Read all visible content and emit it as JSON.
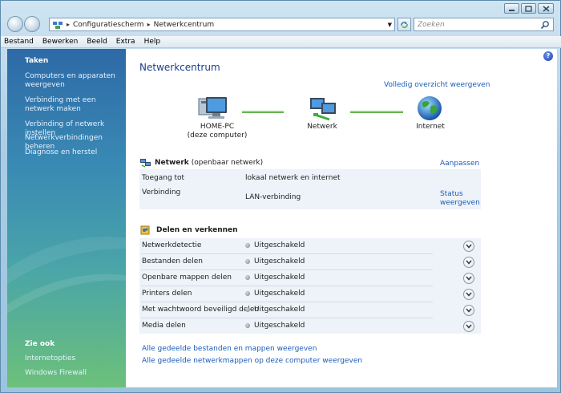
{
  "window": {
    "minimize": "",
    "maximize": "",
    "close": ""
  },
  "address": {
    "crumbs": [
      "Configuratiescherm",
      "Netwerkcentrum"
    ],
    "search_placeholder": "Zoeken"
  },
  "menu": [
    "Bestand",
    "Bewerken",
    "Beeld",
    "Extra",
    "Help"
  ],
  "left_pane": {
    "tasks_heading": "Taken",
    "tasks": [
      "Computers en apparaten weergeven",
      "Verbinding met een netwerk maken",
      "Verbinding of netwerk instellen",
      "Netwerkverbindingen beheren",
      "Diagnose en herstel"
    ],
    "see_also_heading": "Zie ook",
    "see_also": [
      "Internetopties",
      "Windows Firewall"
    ]
  },
  "main": {
    "help": "?",
    "title": "Netwerkcentrum",
    "overview_link": "Volledig overzicht weergeven",
    "map": {
      "pc_name": "HOME-PC",
      "pc_sub": "(deze computer)",
      "network": "Netwerk",
      "internet": "Internet"
    },
    "network": {
      "name": "Netwerk",
      "type": "(openbaar netwerk)",
      "customize": "Aanpassen",
      "access_label": "Toegang tot",
      "access_value": "lokaal netwerk en internet",
      "connection_label": "Verbinding",
      "connection_value": "LAN-verbinding",
      "status_link_1": "Status",
      "status_link_2": "weergeven"
    },
    "sharing": {
      "heading": "Delen en verkennen",
      "rows": [
        {
          "label": "Netwerkdetectie",
          "status": "Uitgeschakeld"
        },
        {
          "label": "Bestanden delen",
          "status": "Uitgeschakeld"
        },
        {
          "label": "Openbare mappen delen",
          "status": "Uitgeschakeld"
        },
        {
          "label": "Printers delen",
          "status": "Uitgeschakeld"
        },
        {
          "label": "Met wachtwoord beveiligd delen",
          "status": "Uitgeschakeld"
        },
        {
          "label": "Media delen",
          "status": "Uitgeschakeld"
        }
      ]
    },
    "bottom_links": [
      "Alle gedeelde bestanden en mappen weergeven",
      "Alle gedeelde netwerkmappen op deze computer weergeven"
    ]
  },
  "colors": {
    "link": "#1a5cb8",
    "title": "#1c3d8c",
    "pane_top": "#2d6aa7",
    "pane_bottom": "#6cc07a",
    "connector": "#7fcf6a"
  }
}
